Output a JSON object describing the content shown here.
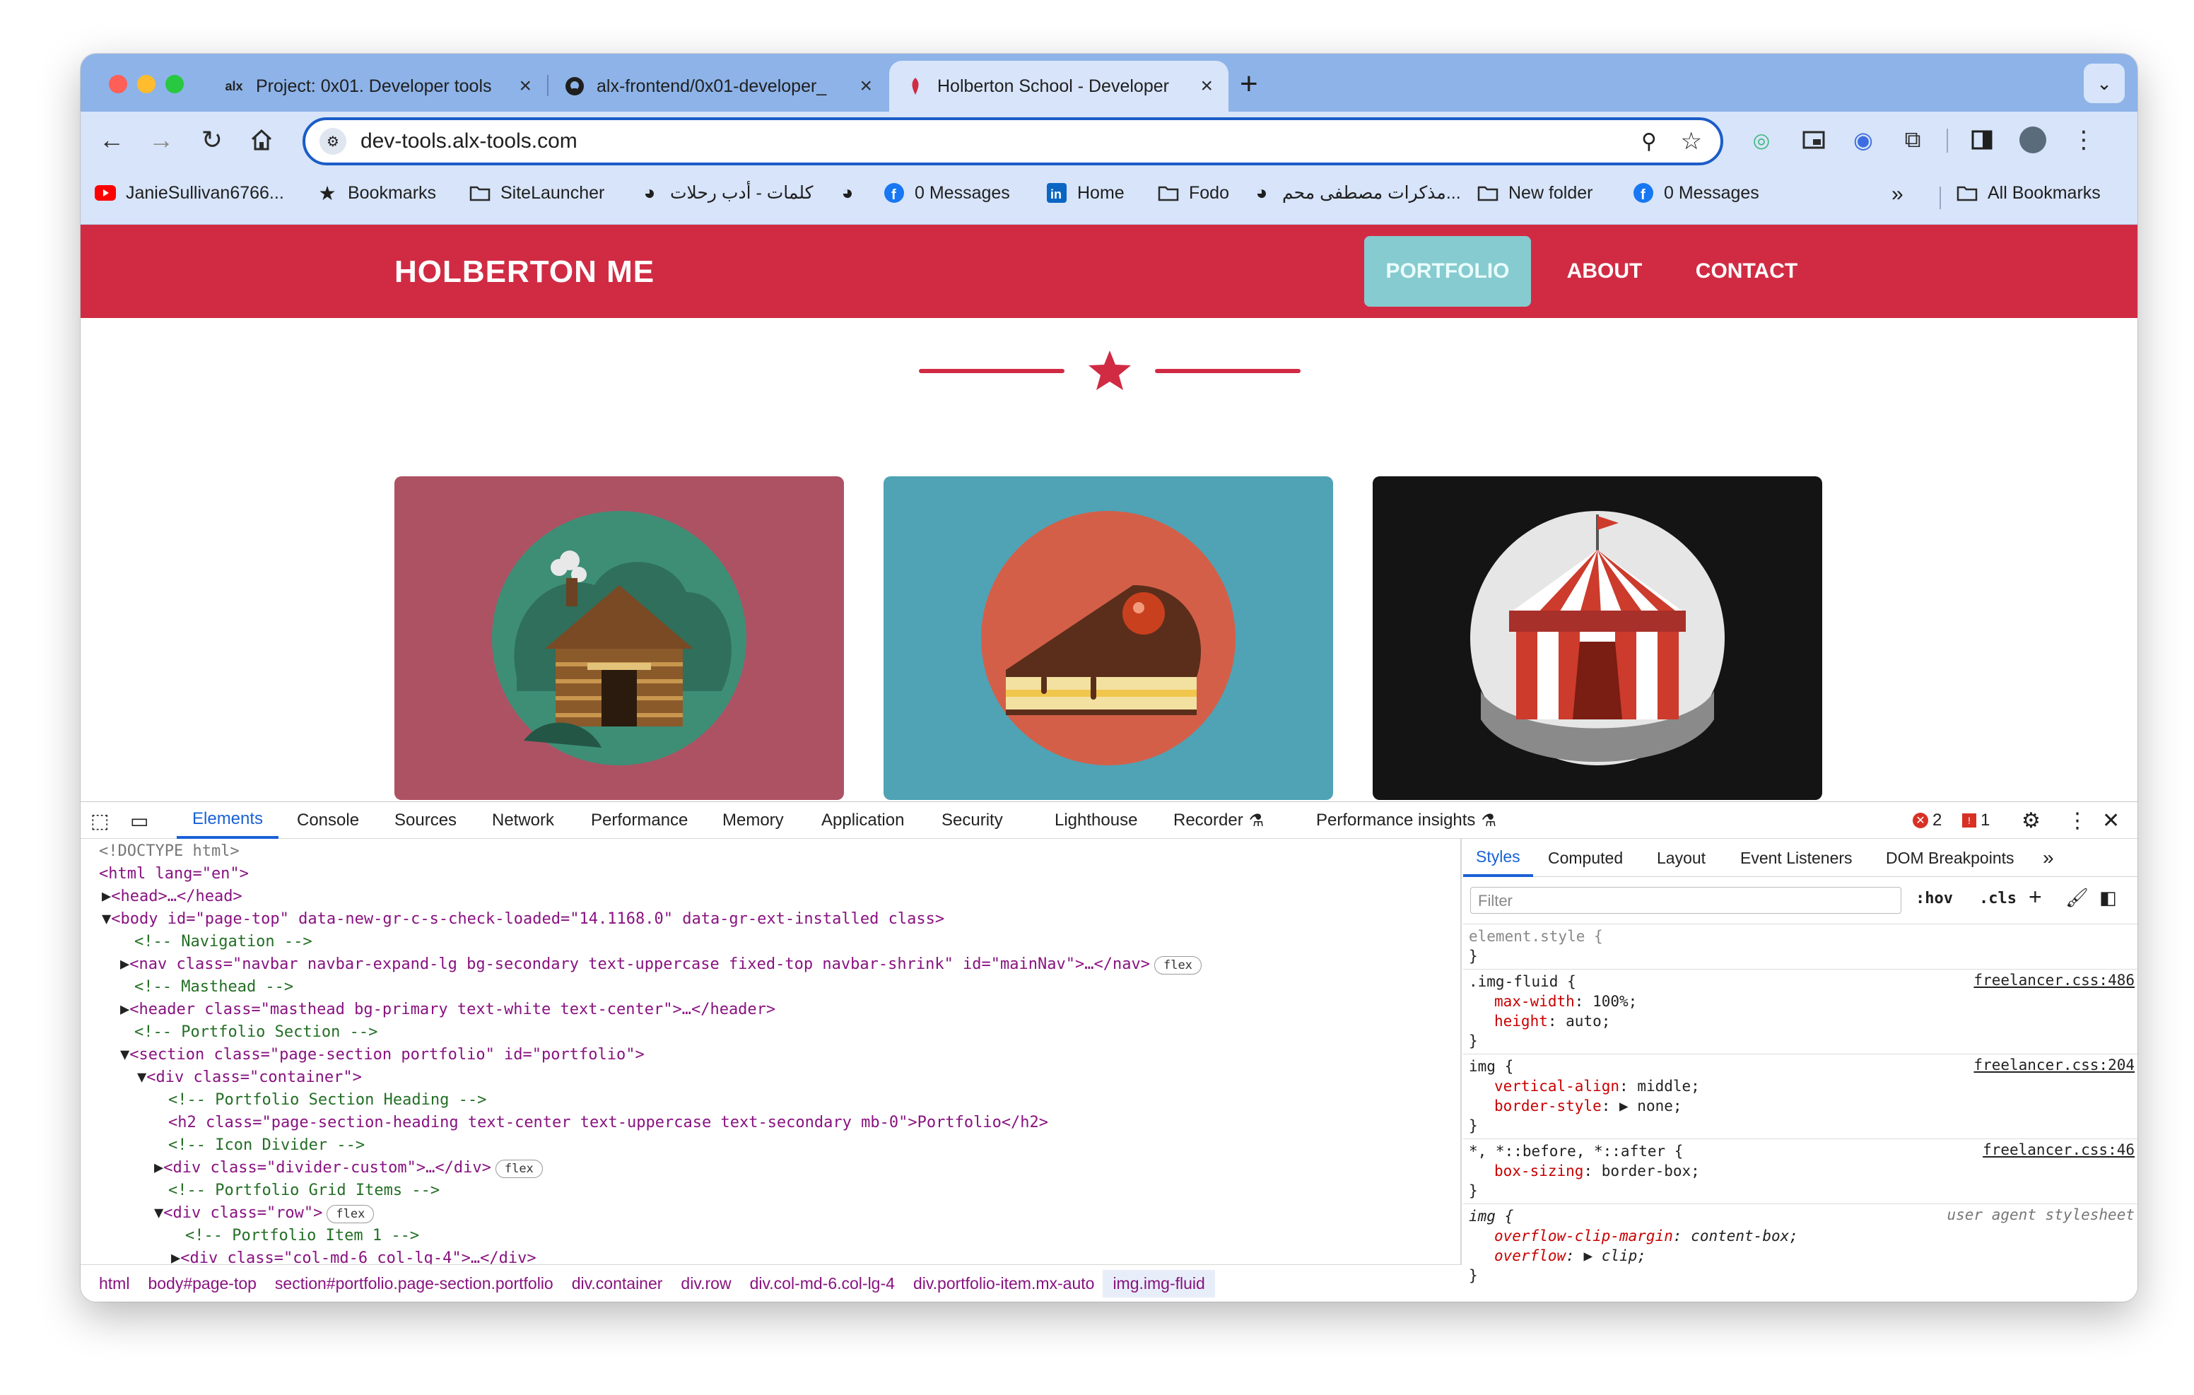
{
  "browser": {
    "tabs": [
      {
        "favicon": "alx",
        "title": "Project: 0x01. Developer tools"
      },
      {
        "favicon": "github-icon",
        "title": "alx-frontend/0x01-developer_"
      },
      {
        "favicon": "holberton-icon",
        "title": "Holberton School - Developer"
      }
    ],
    "url": "dev-tools.alx-tools.com",
    "bookmarks": [
      "JanieSullivan6766...",
      "Bookmarks",
      "SiteLauncher",
      "كلمات - أدب رحلات",
      "",
      "0 Messages",
      "Home",
      "Fodo",
      "مذكرات مصطفى محم...",
      "New folder",
      "0 Messages"
    ],
    "all_bookmarks": "All Bookmarks"
  },
  "site": {
    "brand": "HOLBERTON ME",
    "nav": [
      "PORTFOLIO",
      "ABOUT",
      "CONTACT"
    ],
    "colors": {
      "primary": "#d12b44",
      "active": "#86cbcf",
      "card1": "#ad5263",
      "card2": "#4fa3b5",
      "card3": "#141414"
    }
  },
  "devtools": {
    "tabs": [
      "Elements",
      "Console",
      "Sources",
      "Network",
      "Performance",
      "Memory",
      "Application",
      "Security",
      "Lighthouse",
      "Recorder",
      "Performance insights"
    ],
    "errors": "2",
    "warnings": "1",
    "elements": [
      "<!DOCTYPE html>",
      "<html lang=\"en\">",
      "<head>…</head>",
      "<body id=\"page-top\" data-new-gr-c-s-check-loaded=\"14.1168.0\" data-gr-ext-installed class>",
      "<!-- Navigation -->",
      "<nav class=\"navbar navbar-expand-lg bg-secondary text-uppercase fixed-top navbar-shrink\" id=\"mainNav\">…</nav>",
      "<!-- Masthead -->",
      "<header class=\"masthead bg-primary text-white text-center\">…</header>",
      "<!-- Portfolio Section -->",
      "<section class=\"page-section portfolio\" id=\"portfolio\">",
      "<div class=\"container\">",
      "<!-- Portfolio Section Heading -->",
      "<h2 class=\"page-section-heading text-center text-uppercase text-secondary mb-0\">Portfolio</h2>",
      "<!-- Icon Divider -->",
      "<div class=\"divider-custom\">…</div>",
      "<!-- Portfolio Grid Items -->",
      "<div class=\"row\">",
      "<!-- Portfolio Item 1 -->",
      "<div class=\"col-md-6 col-lg-4\">…</div>"
    ],
    "flex": "flex",
    "breadcrumbs": [
      "html",
      "body#page-top",
      "section#portfolio.page-section.portfolio",
      "div.container",
      "div.row",
      "div.col-md-6.col-lg-4",
      "div.portfolio-item.mx-auto",
      "img.img-fluid"
    ],
    "styles_tabs": [
      "Styles",
      "Computed",
      "Layout",
      "Event Listeners",
      "DOM Breakpoints"
    ],
    "filter_placeholder": "Filter",
    "hov": ":hov",
    "cls": ".cls",
    "rules": [
      {
        "selector": "element.style {",
        "source": "",
        "props": []
      },
      {
        "selector": ".img-fluid {",
        "source": "freelancer.css:486",
        "props": [
          [
            "max-width",
            "100%;"
          ],
          [
            "height",
            "auto;"
          ]
        ]
      },
      {
        "selector": "img {",
        "source": "freelancer.css:204",
        "props": [
          [
            "vertical-align",
            "middle;"
          ],
          [
            "border-style",
            "▶ none;"
          ]
        ]
      },
      {
        "selector": "*, *::before, *::after {",
        "source": "freelancer.css:46",
        "props": [
          [
            "box-sizing",
            "border-box;"
          ]
        ]
      },
      {
        "selector": "img {",
        "source": "user agent stylesheet",
        "props": [
          [
            "overflow-clip-margin",
            "content-box;"
          ],
          [
            "overflow",
            "▶ clip;"
          ]
        ]
      }
    ]
  }
}
